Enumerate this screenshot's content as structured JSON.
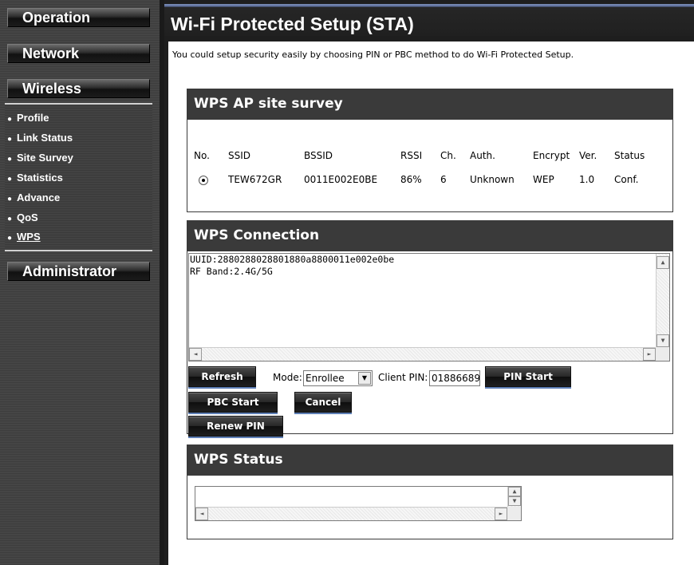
{
  "sidebar": {
    "operation": "Operation",
    "network": "Network",
    "wireless": "Wireless",
    "administrator": "Administrator",
    "items": [
      {
        "label": "Profile"
      },
      {
        "label": "Link Status"
      },
      {
        "label": "Site Survey"
      },
      {
        "label": "Statistics"
      },
      {
        "label": "Advance"
      },
      {
        "label": "QoS"
      },
      {
        "label": "WPS"
      }
    ],
    "bullet": "●"
  },
  "header": {
    "title": "Wi-Fi Protected Setup (STA)"
  },
  "intro": "You could setup security easily by choosing PIN or PBC method to do Wi-Fi Protected Setup.",
  "survey": {
    "title": "WPS AP site survey",
    "columns": [
      "No.",
      "SSID",
      "BSSID",
      "RSSI",
      "Ch.",
      "Auth.",
      "Encrypt",
      "Ver.",
      "Status"
    ],
    "rows": [
      {
        "ssid": "TEW672GR",
        "bssid": "0011E002E0BE",
        "rssi": "86%",
        "ch": "6",
        "auth": "Unknown",
        "encrypt": "WEP",
        "ver": "1.0",
        "status": "Conf."
      }
    ]
  },
  "connection": {
    "title": "WPS Connection",
    "lines": [
      "UUID:2880288028801880a8800011e002e0be",
      "RF Band:2.4G/5G"
    ],
    "refresh": "Refresh",
    "mode_label": "Mode:",
    "mode_value": "Enrollee",
    "client_pin_label": "Client PIN:",
    "client_pin_value": "01886689",
    "pin_start": "PIN Start",
    "pbc_start": "PBC Start",
    "cancel": "Cancel",
    "renew_pin": "Renew PIN"
  },
  "status": {
    "title": "WPS Status"
  },
  "icons": {
    "up": "▲",
    "down": "▼",
    "left": "◄",
    "right": "►"
  }
}
